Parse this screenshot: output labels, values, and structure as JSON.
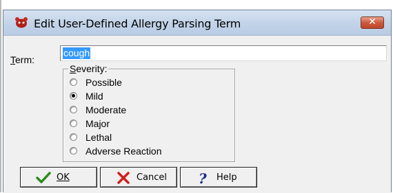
{
  "window": {
    "title": "Edit User-Defined Allergy Parsing Term",
    "close_symbol": "✕"
  },
  "term": {
    "label": "Term:",
    "value": "cough"
  },
  "severity": {
    "legend": "Severity:",
    "options": [
      {
        "label": "Possible",
        "checked": false
      },
      {
        "label": "Mild",
        "checked": true
      },
      {
        "label": "Moderate",
        "checked": false
      },
      {
        "label": "Major",
        "checked": false
      },
      {
        "label": "Lethal",
        "checked": false
      },
      {
        "label": "Adverse Reaction",
        "checked": false
      }
    ]
  },
  "buttons": {
    "ok": "OK",
    "cancel": "Cancel",
    "help": "Help"
  },
  "icons": {
    "app": "allergy-app-icon",
    "ok": "checkmark-icon",
    "cancel": "red-x-icon",
    "help": "question-mark-icon"
  },
  "colors": {
    "selection": "#3399ff",
    "ok_check": "#2d8a1e",
    "cancel_x": "#d0201a",
    "help_q": "#1a2a8c"
  }
}
